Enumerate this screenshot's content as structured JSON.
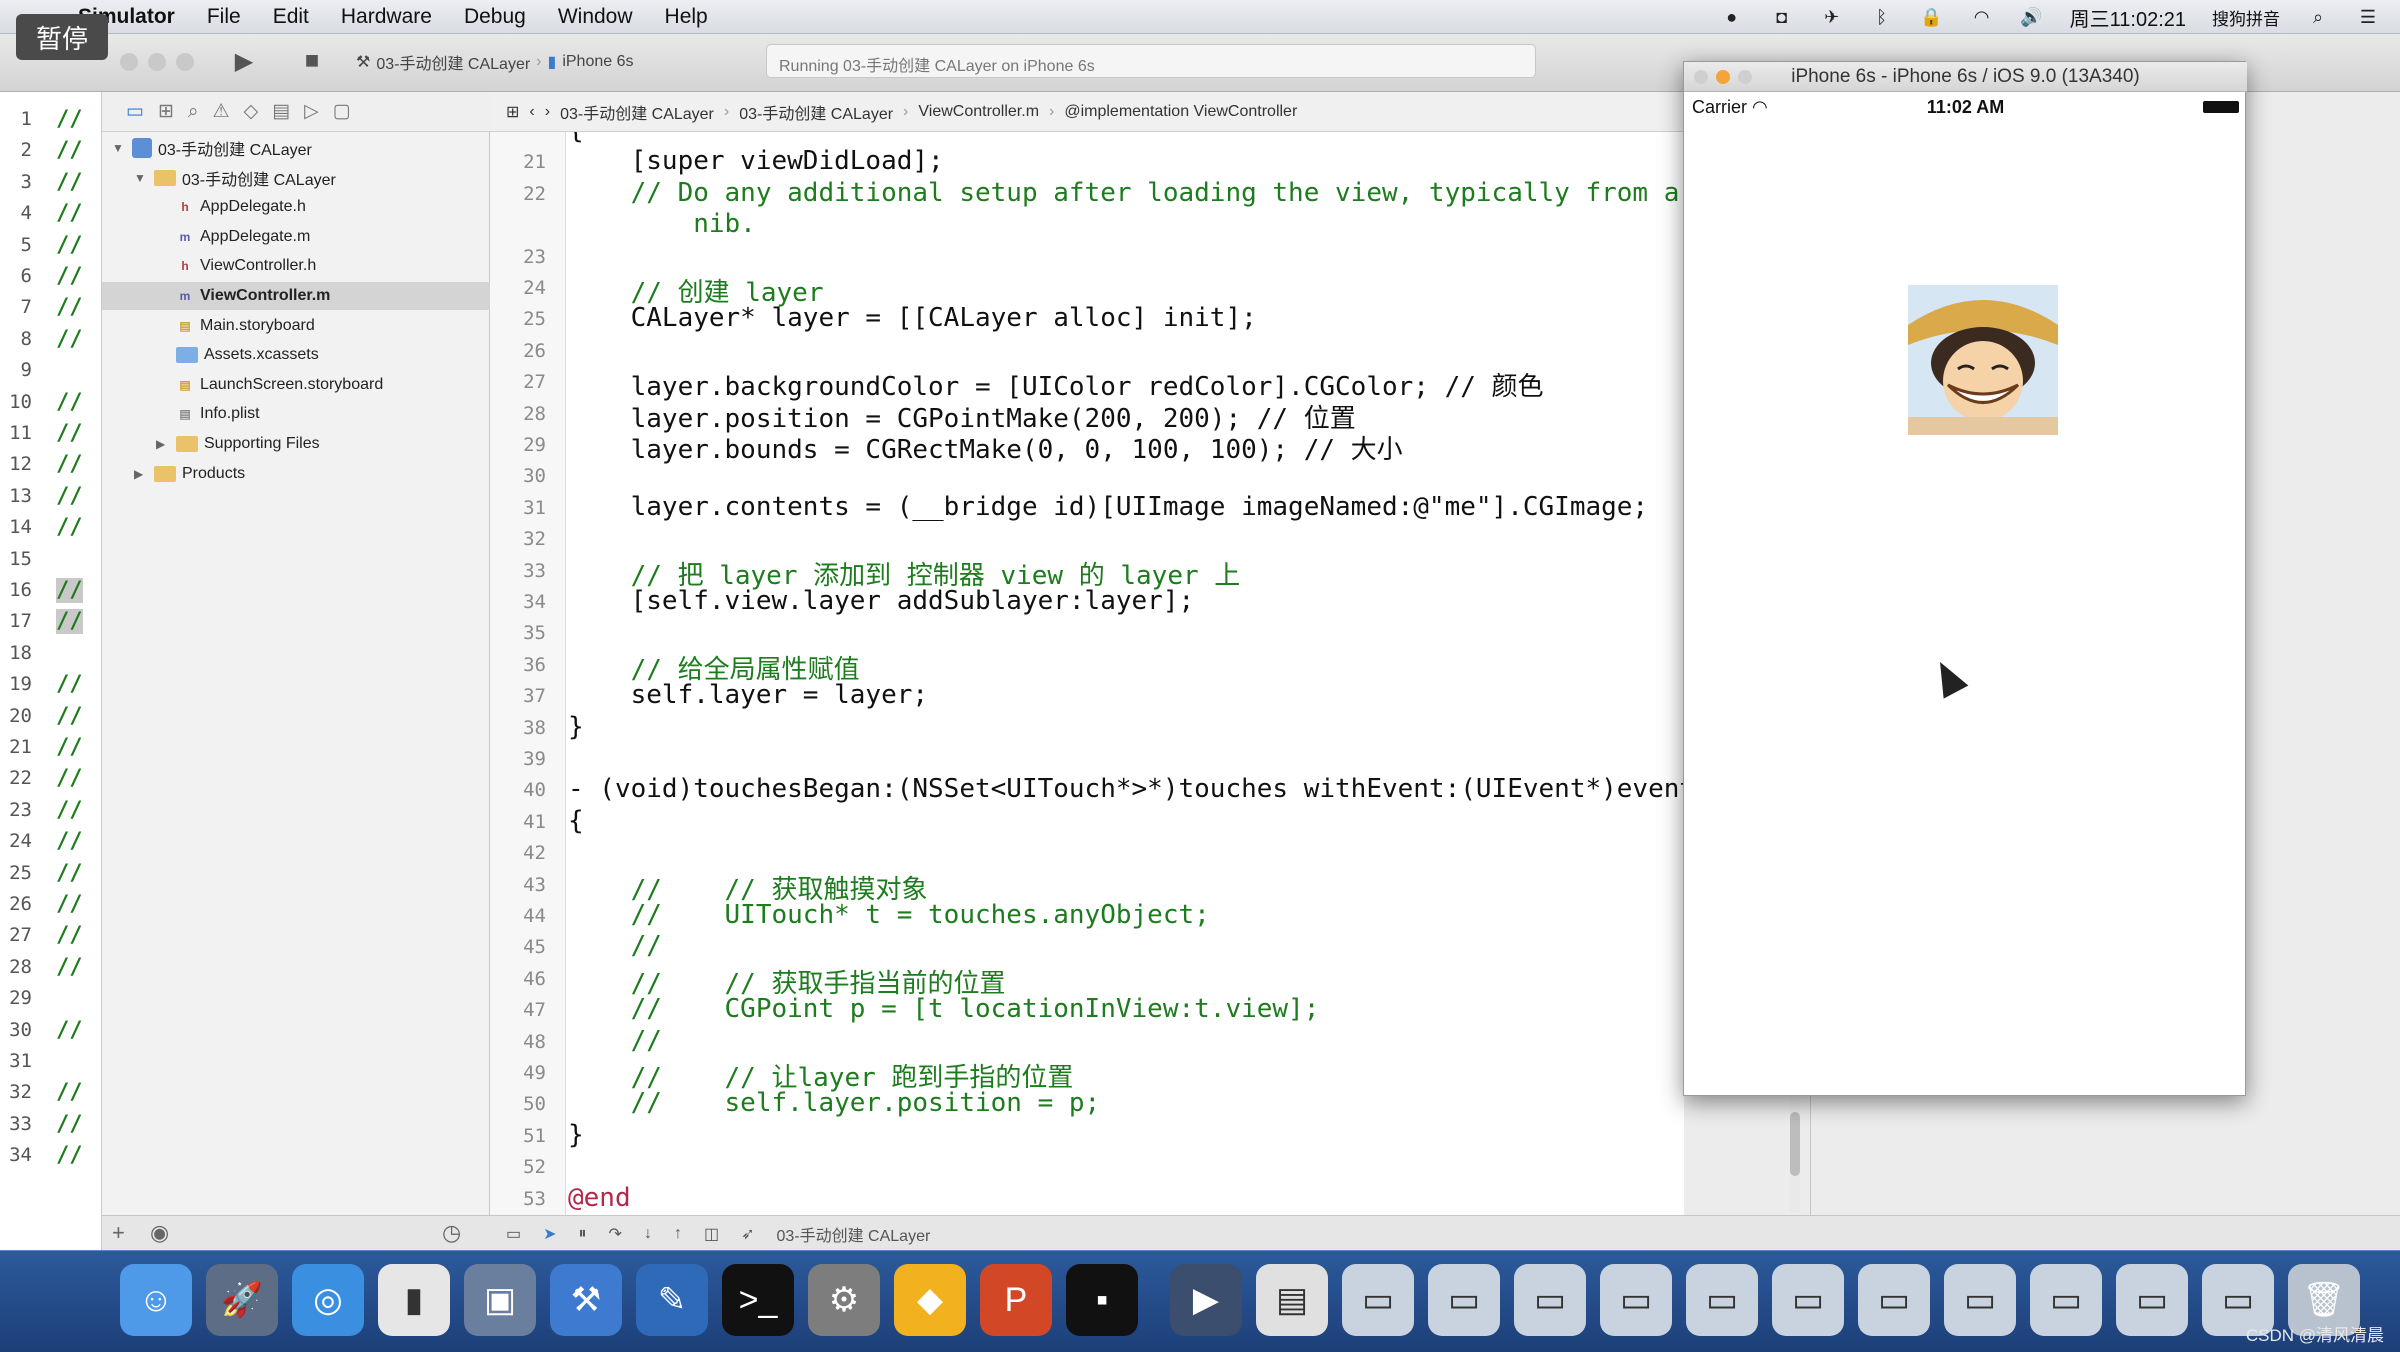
{
  "menubar": {
    "app": "Simulator",
    "items": [
      "File",
      "Edit",
      "Hardware",
      "Debug",
      "Window",
      "Help"
    ],
    "clock": "周三11:02:21",
    "input_method": "搜狗拼音"
  },
  "pause_badge": "暂停",
  "toolbar": {
    "scheme": "03-手动创建 CALayer",
    "device": "iPhone 6s",
    "activity": "Running 03-手动创建 CALayer on iPhone 6s"
  },
  "navigator": {
    "items": [
      {
        "label": "03-手动创建 CALayer",
        "kind": "project",
        "indent": 0,
        "expanded": true
      },
      {
        "label": "03-手动创建 CALayer",
        "kind": "folder",
        "indent": 1,
        "expanded": true
      },
      {
        "label": "AppDelegate.h",
        "kind": "h",
        "indent": 2
      },
      {
        "label": "AppDelegate.m",
        "kind": "m",
        "indent": 2
      },
      {
        "label": "ViewController.h",
        "kind": "h",
        "indent": 2
      },
      {
        "label": "ViewController.m",
        "kind": "m",
        "indent": 2,
        "selected": true
      },
      {
        "label": "Main.storyboard",
        "kind": "storyboard",
        "indent": 2
      },
      {
        "label": "Assets.xcassets",
        "kind": "assets",
        "indent": 2
      },
      {
        "label": "LaunchScreen.storyboard",
        "kind": "storyboard",
        "indent": 2
      },
      {
        "label": "Info.plist",
        "kind": "plist",
        "indent": 2
      },
      {
        "label": "Supporting Files",
        "kind": "folder",
        "indent": 2,
        "expanded": false
      },
      {
        "label": "Products",
        "kind": "folder",
        "indent": 1,
        "expanded": false
      }
    ]
  },
  "jumpbar": {
    "crumbs": [
      "03-手动创建 CALayer",
      "03-手动创建 CALayer",
      "ViewController.m",
      "@implementation ViewController"
    ]
  },
  "strip_lines": [
    {
      "n": "1",
      "c": "//"
    },
    {
      "n": "2",
      "c": "//"
    },
    {
      "n": "3",
      "c": "//"
    },
    {
      "n": "4",
      "c": "//"
    },
    {
      "n": "5",
      "c": "//"
    },
    {
      "n": "6",
      "c": "//"
    },
    {
      "n": "7",
      "c": "//"
    },
    {
      "n": "8",
      "c": "//"
    },
    {
      "n": "9",
      "c": ""
    },
    {
      "n": "10",
      "c": "//"
    },
    {
      "n": "11",
      "c": "//"
    },
    {
      "n": "12",
      "c": "//"
    },
    {
      "n": "13",
      "c": "//"
    },
    {
      "n": "14",
      "c": "//"
    },
    {
      "n": "15",
      "c": ""
    },
    {
      "n": "16",
      "c": "//",
      "hl": true
    },
    {
      "n": "17",
      "c": "//",
      "hl": true
    },
    {
      "n": "18",
      "c": ""
    },
    {
      "n": "19",
      "c": "//"
    },
    {
      "n": "20",
      "c": "//"
    },
    {
      "n": "21",
      "c": "//"
    },
    {
      "n": "22",
      "c": "//"
    },
    {
      "n": "23",
      "c": "//"
    },
    {
      "n": "24",
      "c": "//"
    },
    {
      "n": "25",
      "c": "//"
    },
    {
      "n": "26",
      "c": "//"
    },
    {
      "n": "27",
      "c": "//"
    },
    {
      "n": "28",
      "c": "//"
    },
    {
      "n": "29",
      "c": ""
    },
    {
      "n": "30",
      "c": "//"
    },
    {
      "n": "31",
      "c": ""
    },
    {
      "n": "32",
      "c": "//"
    },
    {
      "n": "33",
      "c": "//"
    },
    {
      "n": "34",
      "c": "//"
    }
  ],
  "code_lines": [
    {
      "n": "",
      "t": "{",
      "k": "fn"
    },
    {
      "n": "21",
      "t": "    [super viewDidLoad];",
      "k": "fn"
    },
    {
      "n": "22",
      "t": "    // Do any additional setup after loading the view, typically from a",
      "k": "cm"
    },
    {
      "n": "",
      "t": "        nib.",
      "k": "cm"
    },
    {
      "n": "23",
      "t": "",
      "k": "fn"
    },
    {
      "n": "24",
      "t": "    // 创建 layer",
      "k": "cm"
    },
    {
      "n": "25",
      "t": "    CALayer* layer = [[CALayer alloc] init];",
      "k": "fn"
    },
    {
      "n": "26",
      "t": "",
      "k": "fn"
    },
    {
      "n": "27",
      "t": "    layer.backgroundColor = [UIColor redColor].CGColor; // 颜色",
      "k": "fn"
    },
    {
      "n": "28",
      "t": "    layer.position = CGPointMake(200, 200); // 位置",
      "k": "fn"
    },
    {
      "n": "29",
      "t": "    layer.bounds = CGRectMake(0, 0, 100, 100); // 大小",
      "k": "fn"
    },
    {
      "n": "30",
      "t": "",
      "k": "fn"
    },
    {
      "n": "31",
      "t": "    layer.contents = (__bridge id)[UIImage imageNamed:@\"me\"].CGImage;",
      "k": "fn"
    },
    {
      "n": "32",
      "t": "",
      "k": "fn"
    },
    {
      "n": "33",
      "t": "    // 把 layer 添加到 控制器 view 的 layer 上",
      "k": "cm"
    },
    {
      "n": "34",
      "t": "    [self.view.layer addSublayer:layer];",
      "k": "fn"
    },
    {
      "n": "35",
      "t": "",
      "k": "fn"
    },
    {
      "n": "36",
      "t": "    // 给全局属性赋值",
      "k": "cm"
    },
    {
      "n": "37",
      "t": "    self.layer = layer;",
      "k": "fn"
    },
    {
      "n": "38",
      "t": "}",
      "k": "fn"
    },
    {
      "n": "39",
      "t": "",
      "k": "fn"
    },
    {
      "n": "40",
      "t": "- (void)touchesBegan:(NSSet<UITouch*>*)touches withEvent:(UIEvent*)event",
      "k": "fn"
    },
    {
      "n": "41",
      "t": "{",
      "k": "fn"
    },
    {
      "n": "42",
      "t": "",
      "k": "fn"
    },
    {
      "n": "43",
      "t": "    //    // 获取触摸对象",
      "k": "cm"
    },
    {
      "n": "44",
      "t": "    //    UITouch* t = touches.anyObject;",
      "k": "cm"
    },
    {
      "n": "45",
      "t": "    //",
      "k": "cm"
    },
    {
      "n": "46",
      "t": "    //    // 获取手指当前的位置",
      "k": "cm"
    },
    {
      "n": "47",
      "t": "    //    CGPoint p = [t locationInView:t.view];",
      "k": "cm"
    },
    {
      "n": "48",
      "t": "    //",
      "k": "cm"
    },
    {
      "n": "49",
      "t": "    //    // 让layer 跑到手指的位置",
      "k": "cm"
    },
    {
      "n": "50",
      "t": "    //    self.layer.position = p;",
      "k": "cm"
    },
    {
      "n": "51",
      "t": "}",
      "k": "fn"
    },
    {
      "n": "52",
      "t": "",
      "k": "fn"
    },
    {
      "n": "53",
      "t": "@end",
      "k": "at"
    }
  ],
  "editor_bottom": {
    "target": "03-手动创建 CALayer"
  },
  "simulator": {
    "title": "iPhone 6s - iPhone 6s / iOS 9.0 (13A340)",
    "carrier": "Carrier",
    "time": "11:02 AM"
  },
  "dock": {
    "apps": [
      {
        "name": "finder-icon",
        "glyph": "☺",
        "color": "#4f9ae8"
      },
      {
        "name": "launchpad-icon",
        "glyph": "🚀",
        "color": "#5d6d86"
      },
      {
        "name": "safari-icon",
        "glyph": "◎",
        "color": "#3a8fe0"
      },
      {
        "name": "mouse-icon",
        "glyph": "▮",
        "color": "#e6e6e6"
      },
      {
        "name": "photo-slideshow-icon",
        "glyph": "▣",
        "color": "#6a7f9e"
      },
      {
        "name": "xcode-icon",
        "glyph": "⚒",
        "color": "#3d7ad0"
      },
      {
        "name": "instruments-icon",
        "glyph": "✎",
        "color": "#2f6ab8"
      },
      {
        "name": "terminal-icon",
        "glyph": ">_",
        "color": "#111111"
      },
      {
        "name": "system-preferences-icon",
        "glyph": "⚙",
        "color": "#7d7d7d"
      },
      {
        "name": "sketch-icon",
        "glyph": "◆",
        "color": "#f2b11f"
      },
      {
        "name": "powerpoint-icon",
        "glyph": "P",
        "color": "#d24726"
      },
      {
        "name": "console-icon",
        "glyph": "▪",
        "color": "#111111"
      },
      {
        "name": "quicktime-icon",
        "glyph": "▶",
        "color": "#3b4e6e"
      },
      {
        "name": "preview-icon",
        "glyph": "▤",
        "color": "#e0e0e0"
      },
      {
        "name": "window-thumb-1-icon",
        "glyph": "▭",
        "color": "#c9d3e0"
      },
      {
        "name": "window-thumb-2-icon",
        "glyph": "▭",
        "color": "#c9d3e0"
      },
      {
        "name": "window-thumb-3-icon",
        "glyph": "▭",
        "color": "#c9d3e0"
      },
      {
        "name": "window-thumb-4-icon",
        "glyph": "▭",
        "color": "#c9d3e0"
      },
      {
        "name": "window-thumb-5-icon",
        "glyph": "▭",
        "color": "#c9d3e0"
      },
      {
        "name": "window-thumb-6-icon",
        "glyph": "▭",
        "color": "#c9d3e0"
      },
      {
        "name": "window-thumb-7-icon",
        "glyph": "▭",
        "color": "#c9d3e0"
      },
      {
        "name": "window-thumb-8-icon",
        "glyph": "▭",
        "color": "#c9d3e0"
      },
      {
        "name": "window-thumb-9-icon",
        "glyph": "▭",
        "color": "#c9d3e0"
      },
      {
        "name": "window-thumb-10-icon",
        "glyph": "▭",
        "color": "#c9d3e0"
      },
      {
        "name": "window-thumb-11-icon",
        "glyph": "▭",
        "color": "#c9d3e0"
      },
      {
        "name": "trash-icon",
        "glyph": "🗑",
        "color": "#b8c2cf"
      }
    ]
  },
  "watermark": "CSDN @清风清晨"
}
